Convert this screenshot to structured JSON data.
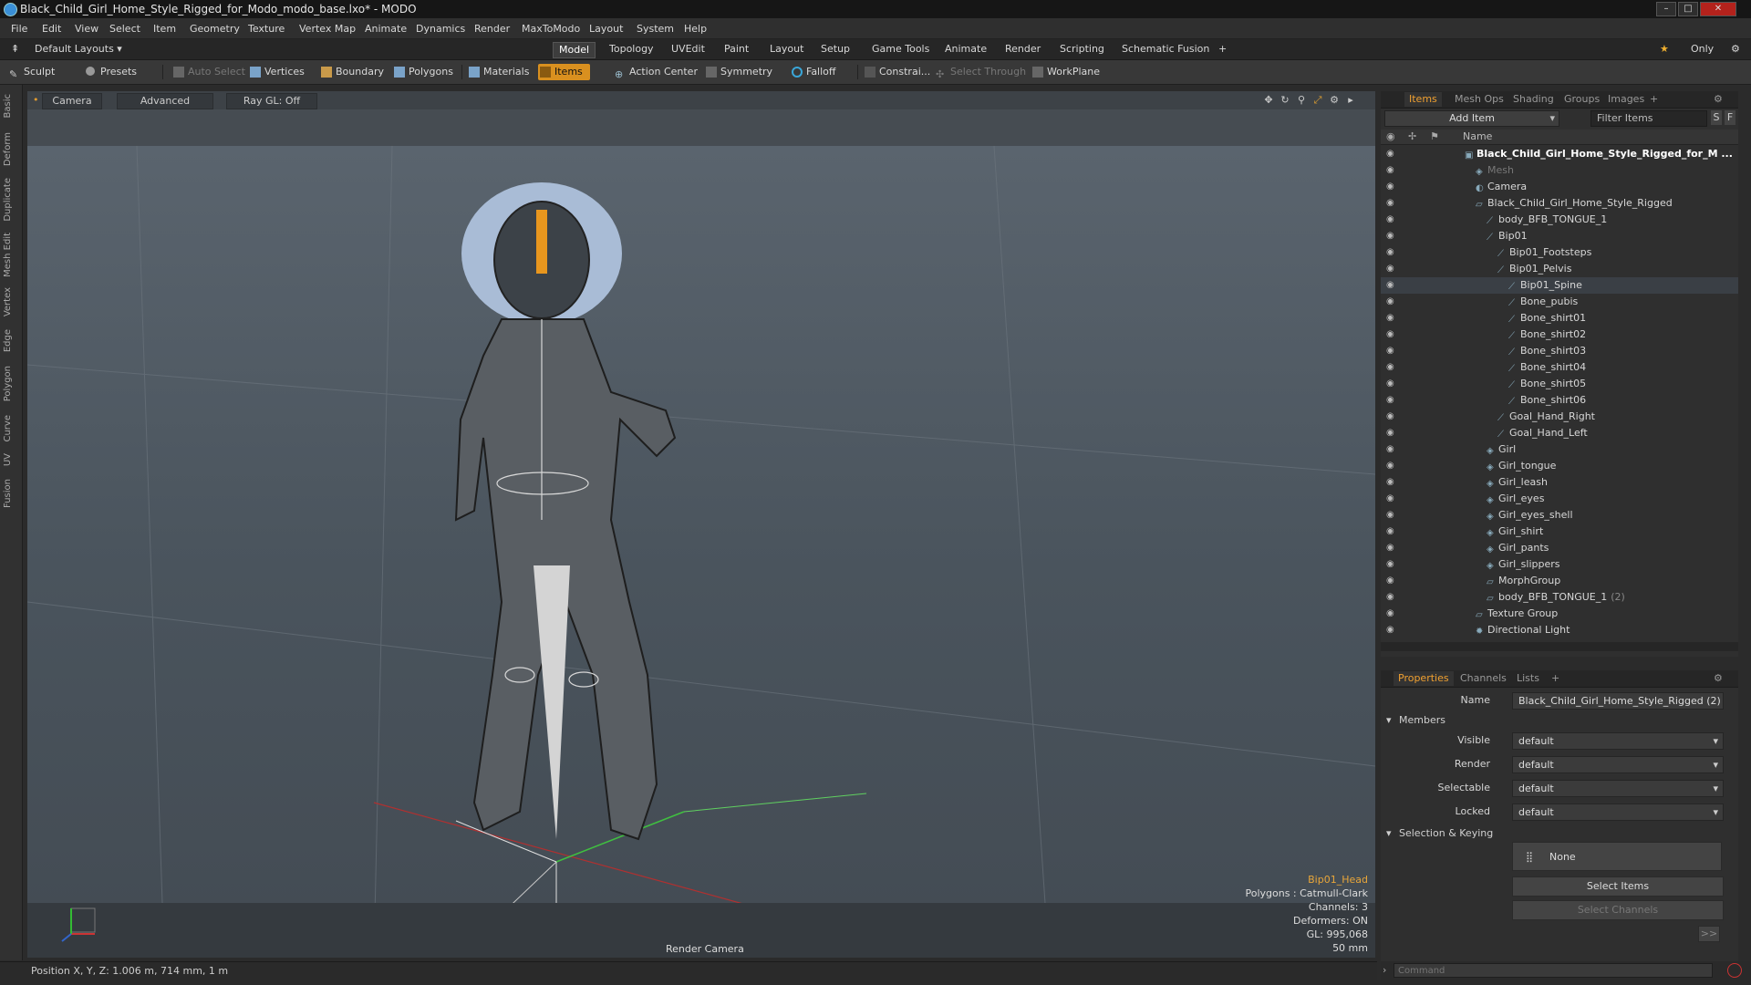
{
  "window": {
    "title": "Black_Child_Girl_Home_Style_Rigged_for_Modo_modo_base.lxo* - MODO"
  },
  "menu": [
    "File",
    "Edit",
    "View",
    "Select",
    "Item",
    "Geometry",
    "Texture",
    "Vertex Map",
    "Animate",
    "Dynamics",
    "Render",
    "MaxToModo",
    "Layout",
    "System",
    "Help"
  ],
  "layout": {
    "preset": "Default Layouts ▾",
    "tabs": [
      "Model",
      "Topology",
      "UVEdit",
      "Paint",
      "Layout",
      "Setup",
      "Game Tools",
      "Animate",
      "Render",
      "Scripting",
      "Schematic Fusion"
    ],
    "active_tab": "Model",
    "only_label": "Only"
  },
  "toolbar": {
    "sculpt": "Sculpt",
    "presets": "Presets",
    "auto_select": "Auto Select",
    "vertices": "Vertices",
    "boundary": "Boundary",
    "polygons": "Polygons",
    "materials": "Materials",
    "items": "Items",
    "action_center": "Action Center",
    "symmetry": "Symmetry",
    "falloff": "Falloff",
    "constraints": "Constrai...",
    "select_through": "Select Through",
    "workplane": "WorkPlane"
  },
  "left_tabs": [
    "Basic",
    "Deform",
    "Duplicate",
    "Mesh Edit",
    "Vertex",
    "Edge",
    "Polygon",
    "Curve",
    "UV",
    "Fusion"
  ],
  "viewport": {
    "camera": "Camera",
    "advanced": "Advanced",
    "raygl": "Ray GL: Off",
    "selected_item": "Bip01_Head",
    "polygons": "Polygons : Catmull-Clark",
    "channels": "Channels: 3",
    "deformers": "Deformers: ON",
    "gl": "GL: 995,068",
    "focal": "50 mm",
    "render_camera": "Render Camera"
  },
  "items_panel": {
    "tabs": [
      "Items",
      "Mesh Ops",
      "Shading",
      "Groups",
      "Images"
    ],
    "add_item": "Add Item",
    "filter_items": "Filter Items",
    "s_btn": "S",
    "f_btn": "F",
    "col_name": "Name",
    "rows": [
      {
        "label": "Black_Child_Girl_Home_Style_Rigged_for_M ...",
        "indent": 0,
        "icon": "scene"
      },
      {
        "label": "Mesh",
        "indent": 1,
        "icon": "mesh"
      },
      {
        "label": "Camera",
        "indent": 1,
        "icon": "camera"
      },
      {
        "label": "Black_Child_Girl_Home_Style_Rigged",
        "indent": 1,
        "icon": "group"
      },
      {
        "label": "body_BFB_TONGUE_1",
        "indent": 2,
        "icon": "bone"
      },
      {
        "label": "Bip01",
        "indent": 2,
        "icon": "bone"
      },
      {
        "label": "Bip01_Footsteps",
        "indent": 3,
        "icon": "bone"
      },
      {
        "label": "Bip01_Pelvis",
        "indent": 3,
        "icon": "bone"
      },
      {
        "label": "Bip01_Spine",
        "indent": 4,
        "icon": "bone"
      },
      {
        "label": "Bone_pubis",
        "indent": 4,
        "icon": "bone"
      },
      {
        "label": "Bone_shirt01",
        "indent": 4,
        "icon": "bone"
      },
      {
        "label": "Bone_shirt02",
        "indent": 4,
        "icon": "bone"
      },
      {
        "label": "Bone_shirt03",
        "indent": 4,
        "icon": "bone"
      },
      {
        "label": "Bone_shirt04",
        "indent": 4,
        "icon": "bone"
      },
      {
        "label": "Bone_shirt05",
        "indent": 4,
        "icon": "bone"
      },
      {
        "label": "Bone_shirt06",
        "indent": 4,
        "icon": "bone"
      },
      {
        "label": "Goal_Hand_Right",
        "indent": 3,
        "icon": "bone"
      },
      {
        "label": "Goal_Hand_Left",
        "indent": 3,
        "icon": "bone"
      },
      {
        "label": "Girl",
        "indent": 2,
        "icon": "mesh"
      },
      {
        "label": "Girl_tongue",
        "indent": 2,
        "icon": "mesh"
      },
      {
        "label": "Girl_leash",
        "indent": 2,
        "icon": "mesh"
      },
      {
        "label": "Girl_eyes",
        "indent": 2,
        "icon": "mesh"
      },
      {
        "label": "Girl_eyes_shell",
        "indent": 2,
        "icon": "mesh"
      },
      {
        "label": "Girl_shirt",
        "indent": 2,
        "icon": "mesh"
      },
      {
        "label": "Girl_pants",
        "indent": 2,
        "icon": "mesh"
      },
      {
        "label": "Girl_slippers",
        "indent": 2,
        "icon": "mesh"
      },
      {
        "label": "MorphGroup",
        "indent": 2,
        "icon": "group"
      },
      {
        "label": "body_BFB_TONGUE_1",
        "indent": 2,
        "icon": "group",
        "suffix": "(2)"
      },
      {
        "label": "Texture Group",
        "indent": 1,
        "icon": "group"
      },
      {
        "label": "Directional Light",
        "indent": 1,
        "icon": "light"
      }
    ]
  },
  "properties": {
    "tabs": [
      "Properties",
      "Channels",
      "Lists"
    ],
    "name_label": "Name",
    "name_value": "Black_Child_Girl_Home_Style_Rigged (2)",
    "members": "Members",
    "fields": [
      {
        "label": "Visible",
        "value": "default"
      },
      {
        "label": "Render",
        "value": "default"
      },
      {
        "label": "Selectable",
        "value": "default"
      },
      {
        "label": "Locked",
        "value": "default"
      }
    ],
    "sel_keying": "Selection & Keying",
    "none": "None",
    "select_items": "Select Items",
    "select_channels": "Select Channels",
    "more": ">>"
  },
  "status": {
    "position": "Position X, Y, Z:  1.006 m, 714 mm, 1 m",
    "command_placeholder": "Command"
  }
}
